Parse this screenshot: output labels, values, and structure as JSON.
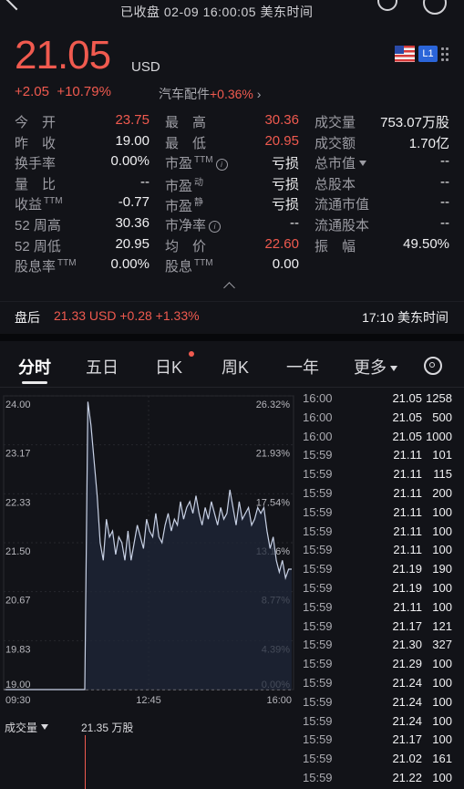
{
  "status": {
    "text": "已收盘   02-09 16:00:05 美东时间"
  },
  "quote": {
    "price": "21.05",
    "currency": "USD",
    "change": "+2.05",
    "change_pct": "+10.79%",
    "sector_name": "汽车配件",
    "sector_pct": "+0.36%",
    "badge": "L1"
  },
  "stats": {
    "col1": [
      {
        "label": "今　开",
        "value": "23.75",
        "color": "red"
      },
      {
        "label": "昨　收",
        "value": "19.00",
        "color": "white"
      },
      {
        "label": "换手率",
        "value": "0.00%",
        "color": "white"
      },
      {
        "label": "量　比",
        "value": "--",
        "color": "white"
      },
      {
        "label": "收益",
        "sup": "TTM",
        "value": "-0.77",
        "color": "white"
      },
      {
        "label": "52 周高",
        "value": "30.36",
        "color": "white"
      },
      {
        "label": "52 周低",
        "value": "20.95",
        "color": "white"
      },
      {
        "label": "股息率",
        "sup": "TTM",
        "value": "0.00%",
        "color": "white"
      }
    ],
    "col2": [
      {
        "label": "最　高",
        "value": "30.36",
        "color": "red"
      },
      {
        "label": "最　低",
        "value": "20.95",
        "color": "red"
      },
      {
        "label": "市盈",
        "sup": "TTM",
        "info": true,
        "value": "亏损",
        "color": "white"
      },
      {
        "label": "市盈",
        "sup": "动",
        "value": "亏损",
        "color": "white"
      },
      {
        "label": "市盈",
        "sup": "静",
        "value": "亏损",
        "color": "white"
      },
      {
        "label": "市净率",
        "info": true,
        "value": "--",
        "color": "white"
      },
      {
        "label": "均　价",
        "value": "22.60",
        "color": "red"
      },
      {
        "label": "股息",
        "sup": "TTM",
        "value": "0.00",
        "color": "white"
      }
    ],
    "col3": [
      {
        "label": "成交量",
        "value": "753.07万股",
        "color": "white"
      },
      {
        "label": "成交额",
        "value": "1.70亿",
        "color": "white"
      },
      {
        "label": "总市值",
        "dropdown": true,
        "value": "--",
        "color": "white"
      },
      {
        "label": "总股本",
        "value": "--",
        "color": "white"
      },
      {
        "label": "流通市值",
        "value": "--",
        "color": "white"
      },
      {
        "label": "流通股本",
        "value": "--",
        "color": "white"
      },
      {
        "label": "振　幅",
        "value": "49.50%",
        "color": "white"
      }
    ]
  },
  "after_hours": {
    "label": "盘后",
    "price": "21.33 USD  +0.28  +1.33%",
    "time": "17:10 美东时间"
  },
  "tabs": [
    "分时",
    "五日",
    "日K",
    "周K",
    "一年",
    "更多"
  ],
  "chart_data": {
    "type": "line",
    "title": "",
    "y_left_ticks": [
      "24.00",
      "23.17",
      "22.33",
      "21.50",
      "20.67",
      "19.83",
      "19.00"
    ],
    "y_right_ticks": [
      "26.32%",
      "21.93%",
      "17.54%",
      "13.16%",
      "8.77%",
      "4.39%",
      "0.00%"
    ],
    "x_ticks": [
      "09:30",
      "12:45",
      "16:00"
    ],
    "ylim": [
      19.0,
      24.0
    ],
    "prev_close": 19.0,
    "series": [
      {
        "values": [
          19.0,
          19.0,
          23.9,
          23.5,
          22.9,
          22.3,
          21.5,
          21.2,
          21.9,
          21.6,
          21.7,
          21.3,
          21.6,
          21.5,
          21.2,
          21.7,
          21.2,
          21.5,
          21.8,
          21.6,
          21.4,
          21.9,
          21.7,
          21.6,
          22.0,
          21.6,
          21.5,
          21.8,
          22.0,
          21.7,
          21.9,
          21.8,
          22.2,
          21.9,
          22.1,
          22.2,
          22.0,
          22.3,
          22.0,
          21.8,
          22.1,
          21.9,
          22.2,
          22.0,
          21.8,
          22.1,
          21.9,
          22.0,
          22.4,
          22.1,
          21.8,
          22.2,
          21.9,
          22.0,
          22.1,
          21.8,
          21.9,
          22.1,
          22.0,
          22.1,
          21.7,
          21.4,
          21.6,
          21.2,
          21.0,
          21.2,
          20.9,
          21.05,
          21.05
        ]
      }
    ]
  },
  "volume": {
    "label": "成交量",
    "value": "21.35 万股"
  },
  "ticks": [
    {
      "time": "16:00",
      "price": "21.05",
      "vol": "1258"
    },
    {
      "time": "16:00",
      "price": "21.05",
      "vol": "500"
    },
    {
      "time": "16:00",
      "price": "21.05",
      "vol": "1000"
    },
    {
      "time": "15:59",
      "price": "21.11",
      "vol": "101"
    },
    {
      "time": "15:59",
      "price": "21.11",
      "vol": "115"
    },
    {
      "time": "15:59",
      "price": "21.11",
      "vol": "200"
    },
    {
      "time": "15:59",
      "price": "21.11",
      "vol": "100"
    },
    {
      "time": "15:59",
      "price": "21.11",
      "vol": "100"
    },
    {
      "time": "15:59",
      "price": "21.11",
      "vol": "100"
    },
    {
      "time": "15:59",
      "price": "21.19",
      "vol": "190"
    },
    {
      "time": "15:59",
      "price": "21.19",
      "vol": "100"
    },
    {
      "time": "15:59",
      "price": "21.11",
      "vol": "100"
    },
    {
      "time": "15:59",
      "price": "21.17",
      "vol": "121"
    },
    {
      "time": "15:59",
      "price": "21.30",
      "vol": "327"
    },
    {
      "time": "15:59",
      "price": "21.29",
      "vol": "100"
    },
    {
      "time": "15:59",
      "price": "21.24",
      "vol": "100"
    },
    {
      "time": "15:59",
      "price": "21.24",
      "vol": "100"
    },
    {
      "time": "15:59",
      "price": "21.24",
      "vol": "100"
    },
    {
      "time": "15:59",
      "price": "21.17",
      "vol": "100"
    },
    {
      "time": "15:59",
      "price": "21.02",
      "vol": "161"
    },
    {
      "time": "15:59",
      "price": "21.22",
      "vol": "100"
    }
  ],
  "colors": {
    "up": "#f05a4f",
    "line": "#c9d2e6",
    "bg": "#121318"
  }
}
